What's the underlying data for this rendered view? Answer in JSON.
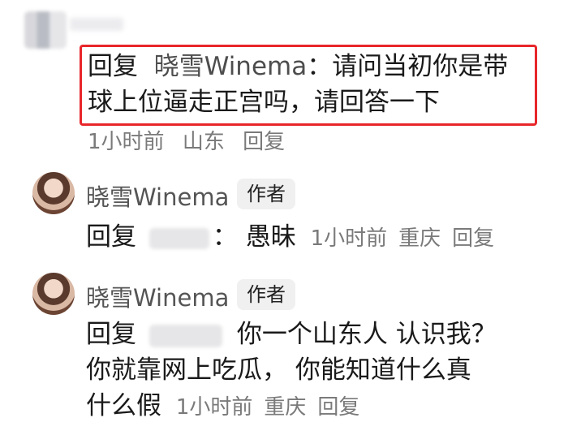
{
  "comments": [
    {
      "reply_label": "回复",
      "reply_to": "晓雪Winema",
      "separator": "：",
      "text": "请问当初你是带球上位逼走正宫吗，请回答一下",
      "time": "1小时前",
      "location": "山东",
      "reply_action": "回复"
    },
    {
      "username": "晓雪Winema",
      "badge": "作者",
      "reply_label": "回复",
      "separator": "：",
      "text": "愚昧",
      "time": "1小时前",
      "location": "重庆",
      "reply_action": "回复"
    },
    {
      "username": "晓雪Winema",
      "badge": "作者",
      "reply_label": "回复",
      "text_line1": "你一个山东人 认识我？",
      "text_line2": "你就靠网上吃瓜， 你能知道什么真",
      "text_line3": "什么假",
      "time": "1小时前",
      "location": "重庆",
      "reply_action": "回复"
    }
  ],
  "colors": {
    "highlight_border": "#e8262a",
    "meta_text": "#7a7a7a"
  }
}
